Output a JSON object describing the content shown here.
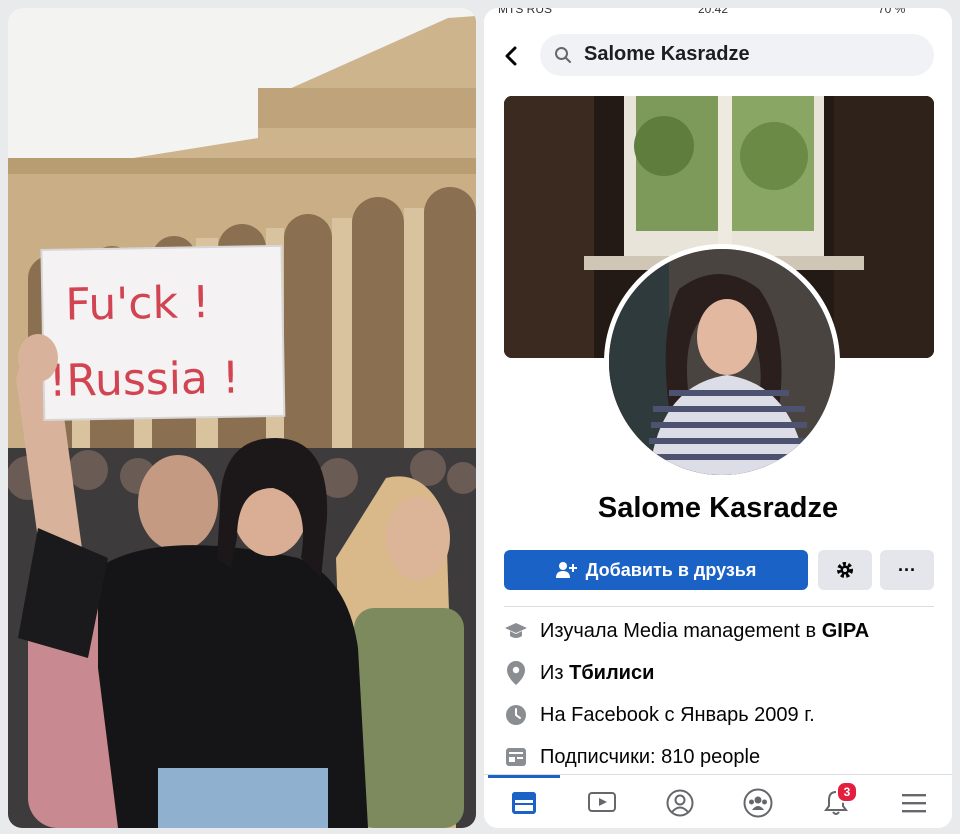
{
  "photo": {
    "sign_line1": "Fu'ck !",
    "sign_line2": "!Russia !"
  },
  "status_bar": {
    "carrier": "MTS RUS",
    "time": "20:42",
    "battery": "70 %"
  },
  "search": {
    "query": "Salome Kasradze"
  },
  "profile": {
    "name": "Salome Kasradze",
    "add_friend_label": "Добавить в друзья",
    "more_label": "···"
  },
  "info": {
    "education_prefix": "Изучала Media management в",
    "education_school": "GIPA",
    "hometown_prefix": "Из",
    "hometown_city": "Тбилиси",
    "joined": "На Facebook с Январь 2009 г.",
    "followers": "Подписчики: 810 people"
  },
  "tabs": [
    {
      "name": "news-feed",
      "icon": "news-feed-icon"
    },
    {
      "name": "watch",
      "icon": "video-icon"
    },
    {
      "name": "profile",
      "icon": "profile-icon"
    },
    {
      "name": "groups",
      "icon": "groups-icon"
    },
    {
      "name": "notifications",
      "icon": "bell-icon",
      "badge": "3"
    },
    {
      "name": "menu",
      "icon": "menu-icon"
    }
  ],
  "colors": {
    "accent": "#1b62c6",
    "badge": "#e41e3f",
    "sign_ink": "#d24452"
  }
}
